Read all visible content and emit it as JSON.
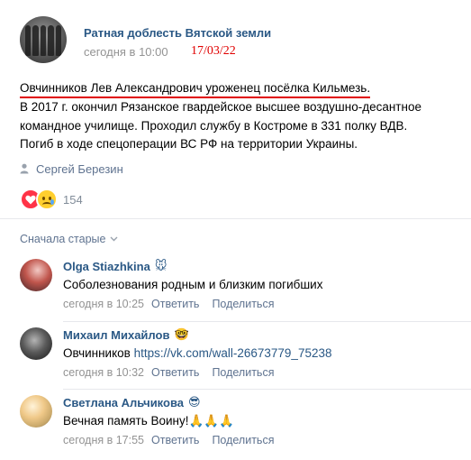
{
  "post": {
    "community_name": "Ратная доблесть Вятской земли",
    "date": "сегодня в 10:00",
    "handwritten_date": "17/03/22",
    "text_lines": [
      "Овчинников Лев Александрович уроженец посёлка Кильмезь.",
      "В 2017 г. окончил Рязанское гвардейское высшее воздушно-десантное",
      "командное училище. Проходил службу в Костроме в 331 полку ВДВ.",
      "Погиб в ходе спецоперации ВС РФ на территории Украины."
    ],
    "signer": "Сергей Березин",
    "signer_icon": "person-icon",
    "reactions": {
      "count": "154",
      "icons": [
        "heart-icon",
        "sad-tear-icon"
      ]
    }
  },
  "comments_section": {
    "sort_label": "Сначала старые",
    "comments": [
      {
        "author": "Olga Stiazhkina",
        "author_emoji": "🐭",
        "text": "Соболезнования родным и близким погибших",
        "link": "",
        "time": "сегодня в 10:25",
        "reply_label": "Ответить",
        "share_label": "Поделиться"
      },
      {
        "author": "Михаил Михайлов",
        "author_emoji": "🤓",
        "text": "Овчинников ",
        "link": "https://vk.com/wall-26673779_75238",
        "time": "сегодня в 10:32",
        "reply_label": "Ответить",
        "share_label": "Поделиться"
      },
      {
        "author": "Светлана Альчикова",
        "author_emoji": "😎",
        "text": "Вечная память Воину!🙏🙏🙏",
        "link": "",
        "time": "сегодня в 17:55",
        "reply_label": "Ответить",
        "share_label": "Поделиться"
      }
    ]
  },
  "colors": {
    "link_blue": "#2a5885",
    "secondary_gray": "#939393",
    "action_blue": "#5f7390",
    "annotation_red": "#e00000",
    "heart_red": "#ff3347"
  }
}
